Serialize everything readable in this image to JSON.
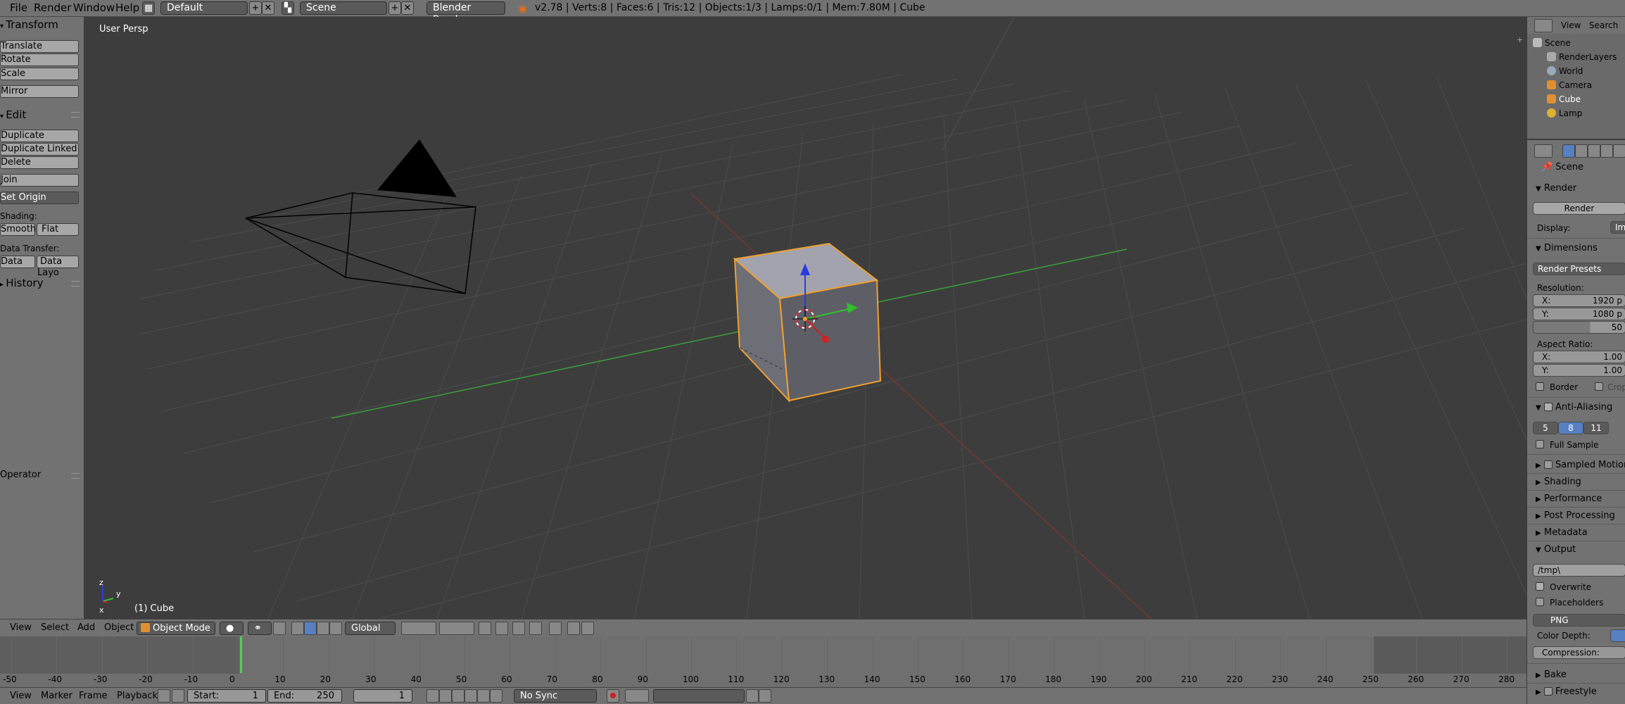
{
  "topbar": {
    "menu": [
      "File",
      "Render",
      "Window",
      "Help"
    ],
    "layout": "Default",
    "scene": "Scene",
    "engine": "Blender Render",
    "info": "v2.78 | Verts:8 | Faces:6 | Tris:12 | Objects:1/3 | Lamps:0/1 | Mem:7.80M | Cube"
  },
  "tool_shelf": {
    "transform_title": "Transform",
    "translate": "Translate",
    "rotate": "Rotate",
    "scale": "Scale",
    "mirror": "Mirror",
    "edit_title": "Edit",
    "duplicate": "Duplicate",
    "duplicate_linked": "Duplicate Linked",
    "delete": "Delete",
    "join": "Join",
    "set_origin": "Set Origin",
    "shading_label": "Shading:",
    "smooth": "Smooth",
    "flat": "Flat",
    "data_transfer_label": "Data Transfer:",
    "data": "Data",
    "data_layout": "Data Layo",
    "history_title": "History",
    "operator_title": "Operator"
  },
  "viewport": {
    "view_label": "User Persp",
    "object_label": "(1) Cube"
  },
  "viewport_header": {
    "view": "View",
    "select": "Select",
    "add": "Add",
    "object": "Object",
    "mode": "Object Mode",
    "orientation": "Global"
  },
  "timeline": {
    "ticks": [
      "-50",
      "-40",
      "-30",
      "-20",
      "-10",
      "0",
      "10",
      "20",
      "30",
      "40",
      "50",
      "60",
      "70",
      "80",
      "90",
      "100",
      "110",
      "120",
      "130",
      "140",
      "150",
      "160",
      "170",
      "180",
      "190",
      "200",
      "210",
      "220",
      "230",
      "240",
      "250",
      "260",
      "270",
      "280"
    ],
    "view": "View",
    "marker": "Marker",
    "frame": "Frame",
    "playback": "Playback",
    "start_label": "Start:",
    "start_value": "1",
    "end_label": "End:",
    "end_value": "250",
    "current_frame": "1",
    "sync": "No Sync"
  },
  "outliner": {
    "view": "View",
    "search": "Search",
    "scene": "Scene",
    "render_layers": "RenderLayers",
    "world": "World",
    "camera": "Camera",
    "cube": "Cube",
    "lamp": "Lamp"
  },
  "properties": {
    "breadcrumb_scene": "Scene",
    "render_title": "Render",
    "render_button": "Render",
    "display_label": "Display:",
    "display_value": "Im",
    "dimensions_title": "Dimensions",
    "render_presets": "Render Presets",
    "resolution_label": "Resolution:",
    "res_x_label": "X:",
    "res_x": "1920 p",
    "res_y_label": "Y:",
    "res_y": "1080 p",
    "res_pct": "50",
    "aspect_label": "Aspect Ratio:",
    "asp_x_label": "X:",
    "asp_x": "1.00",
    "asp_y_label": "Y:",
    "asp_y": "1.00",
    "border": "Border",
    "crop": "Crop",
    "anti_aliasing_title": "Anti-Aliasing",
    "aa_5": "5",
    "aa_8": "8",
    "aa_11": "11",
    "full_sample": "Full Sample",
    "sampled_motion": "Sampled Motion B",
    "shading_title": "Shading",
    "performance_title": "Performance",
    "post_processing_title": "Post Processing",
    "metadata_title": "Metadata",
    "output_title": "Output",
    "output_path": "/tmp\\",
    "overwrite": "Overwrite",
    "placeholders": "Placeholders",
    "format": "PNG",
    "color_depth_label": "Color Depth:",
    "compression_label": "Compression:",
    "bake_title": "Bake",
    "freestyle_title": "Freestyle"
  },
  "colors": {
    "accent_blue": "#5680c2",
    "selection_orange": "#f0a030",
    "grid_green": "#3aa03a",
    "grid_red": "#b03030"
  }
}
